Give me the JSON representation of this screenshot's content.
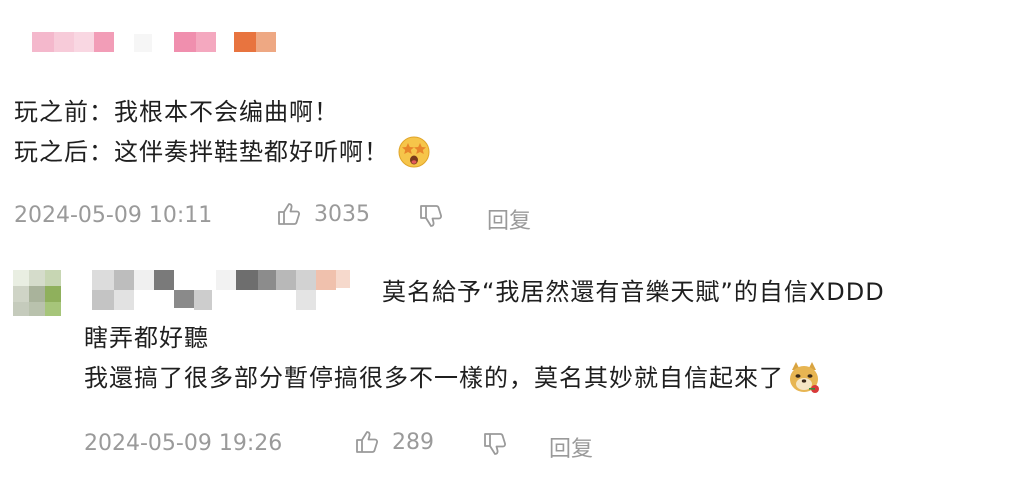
{
  "comments": [
    {
      "lines": [
        "玩之前：我根本不会编曲啊！",
        "玩之后：这伴奏拌鞋垫都好听啊！"
      ],
      "emoji": "star-eyes-emoji",
      "timestamp": "2024-05-09 10:11",
      "likes": "3035",
      "reply_label": "回复"
    },
    {
      "lines": [
        "莫名給予“我居然還有音樂天賦”的自信XDDD",
        "瞎弄都好聽",
        "我還搞了很多部分暫停搞很多不一樣的，莫名其妙就自信起來了"
      ],
      "emoji": "doge-rose-emoji",
      "timestamp": "2024-05-09 19:26",
      "likes": "289",
      "reply_label": "回复"
    }
  ],
  "colors": {
    "text": "#1f1f1f",
    "meta": "#9a9a9a",
    "pink": "#f08fae",
    "orange": "#e8743f"
  },
  "icons": [
    "thumbs-up-icon",
    "thumbs-down-icon"
  ]
}
